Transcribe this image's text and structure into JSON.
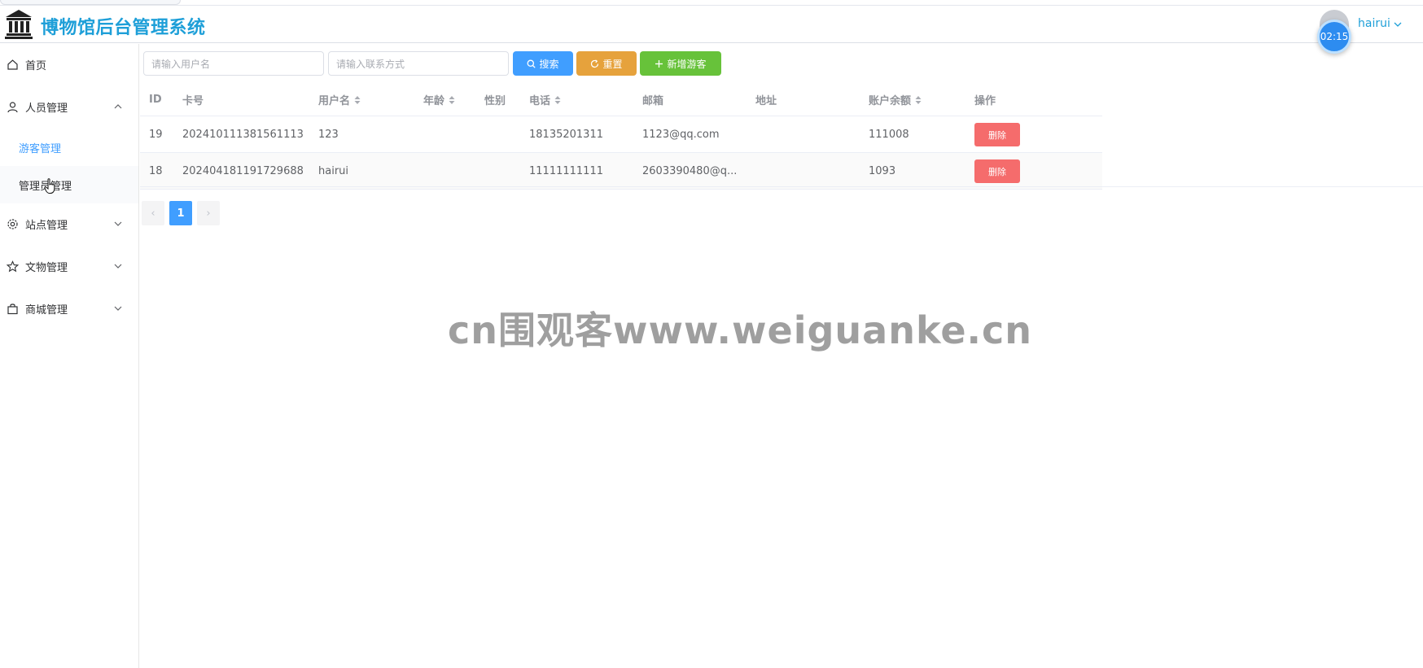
{
  "app": {
    "title": "博物馆后台管理系统",
    "clock": "02:15",
    "user": "hairui"
  },
  "colors": {
    "primary": "#409eff",
    "warning": "#e6a23c",
    "success": "#67c23a",
    "danger": "#f56c6c",
    "title": "#1e9fd8"
  },
  "sidebar": {
    "items": [
      {
        "label": "首页",
        "icon": "home-icon"
      },
      {
        "label": "人员管理",
        "icon": "user-icon",
        "expanded": true,
        "children": [
          {
            "label": "游客管理",
            "active": true
          },
          {
            "label": "管理员管理"
          }
        ]
      },
      {
        "label": "站点管理",
        "icon": "gear-icon"
      },
      {
        "label": "文物管理",
        "icon": "star-icon"
      },
      {
        "label": "商城管理",
        "icon": "bag-icon"
      }
    ]
  },
  "toolbar": {
    "username_placeholder": "请输入用户名",
    "contact_placeholder": "请输入联系方式",
    "search_label": "搜索",
    "reset_label": "重置",
    "add_label": "新增游客"
  },
  "table": {
    "columns": [
      "ID",
      "卡号",
      "用户名",
      "年龄",
      "性别",
      "电话",
      "邮箱",
      "地址",
      "账户余额",
      "操作"
    ],
    "rows": [
      {
        "id": "19",
        "card": "202410111381561113",
        "username": "123",
        "age": "",
        "gender": "",
        "phone": "18135201311",
        "email": "1123@qq.com",
        "address": "",
        "balance": "111008",
        "action": "删除"
      },
      {
        "id": "18",
        "card": "202404181191729688",
        "username": "hairui",
        "age": "",
        "gender": "",
        "phone": "11111111111",
        "email": "2603390480@q...",
        "address": "",
        "balance": "1093",
        "action": "删除"
      }
    ]
  },
  "pagination": {
    "prev": "‹",
    "current": "1",
    "next": "›"
  },
  "watermark": "cn围观客www.weiguanke.cn"
}
